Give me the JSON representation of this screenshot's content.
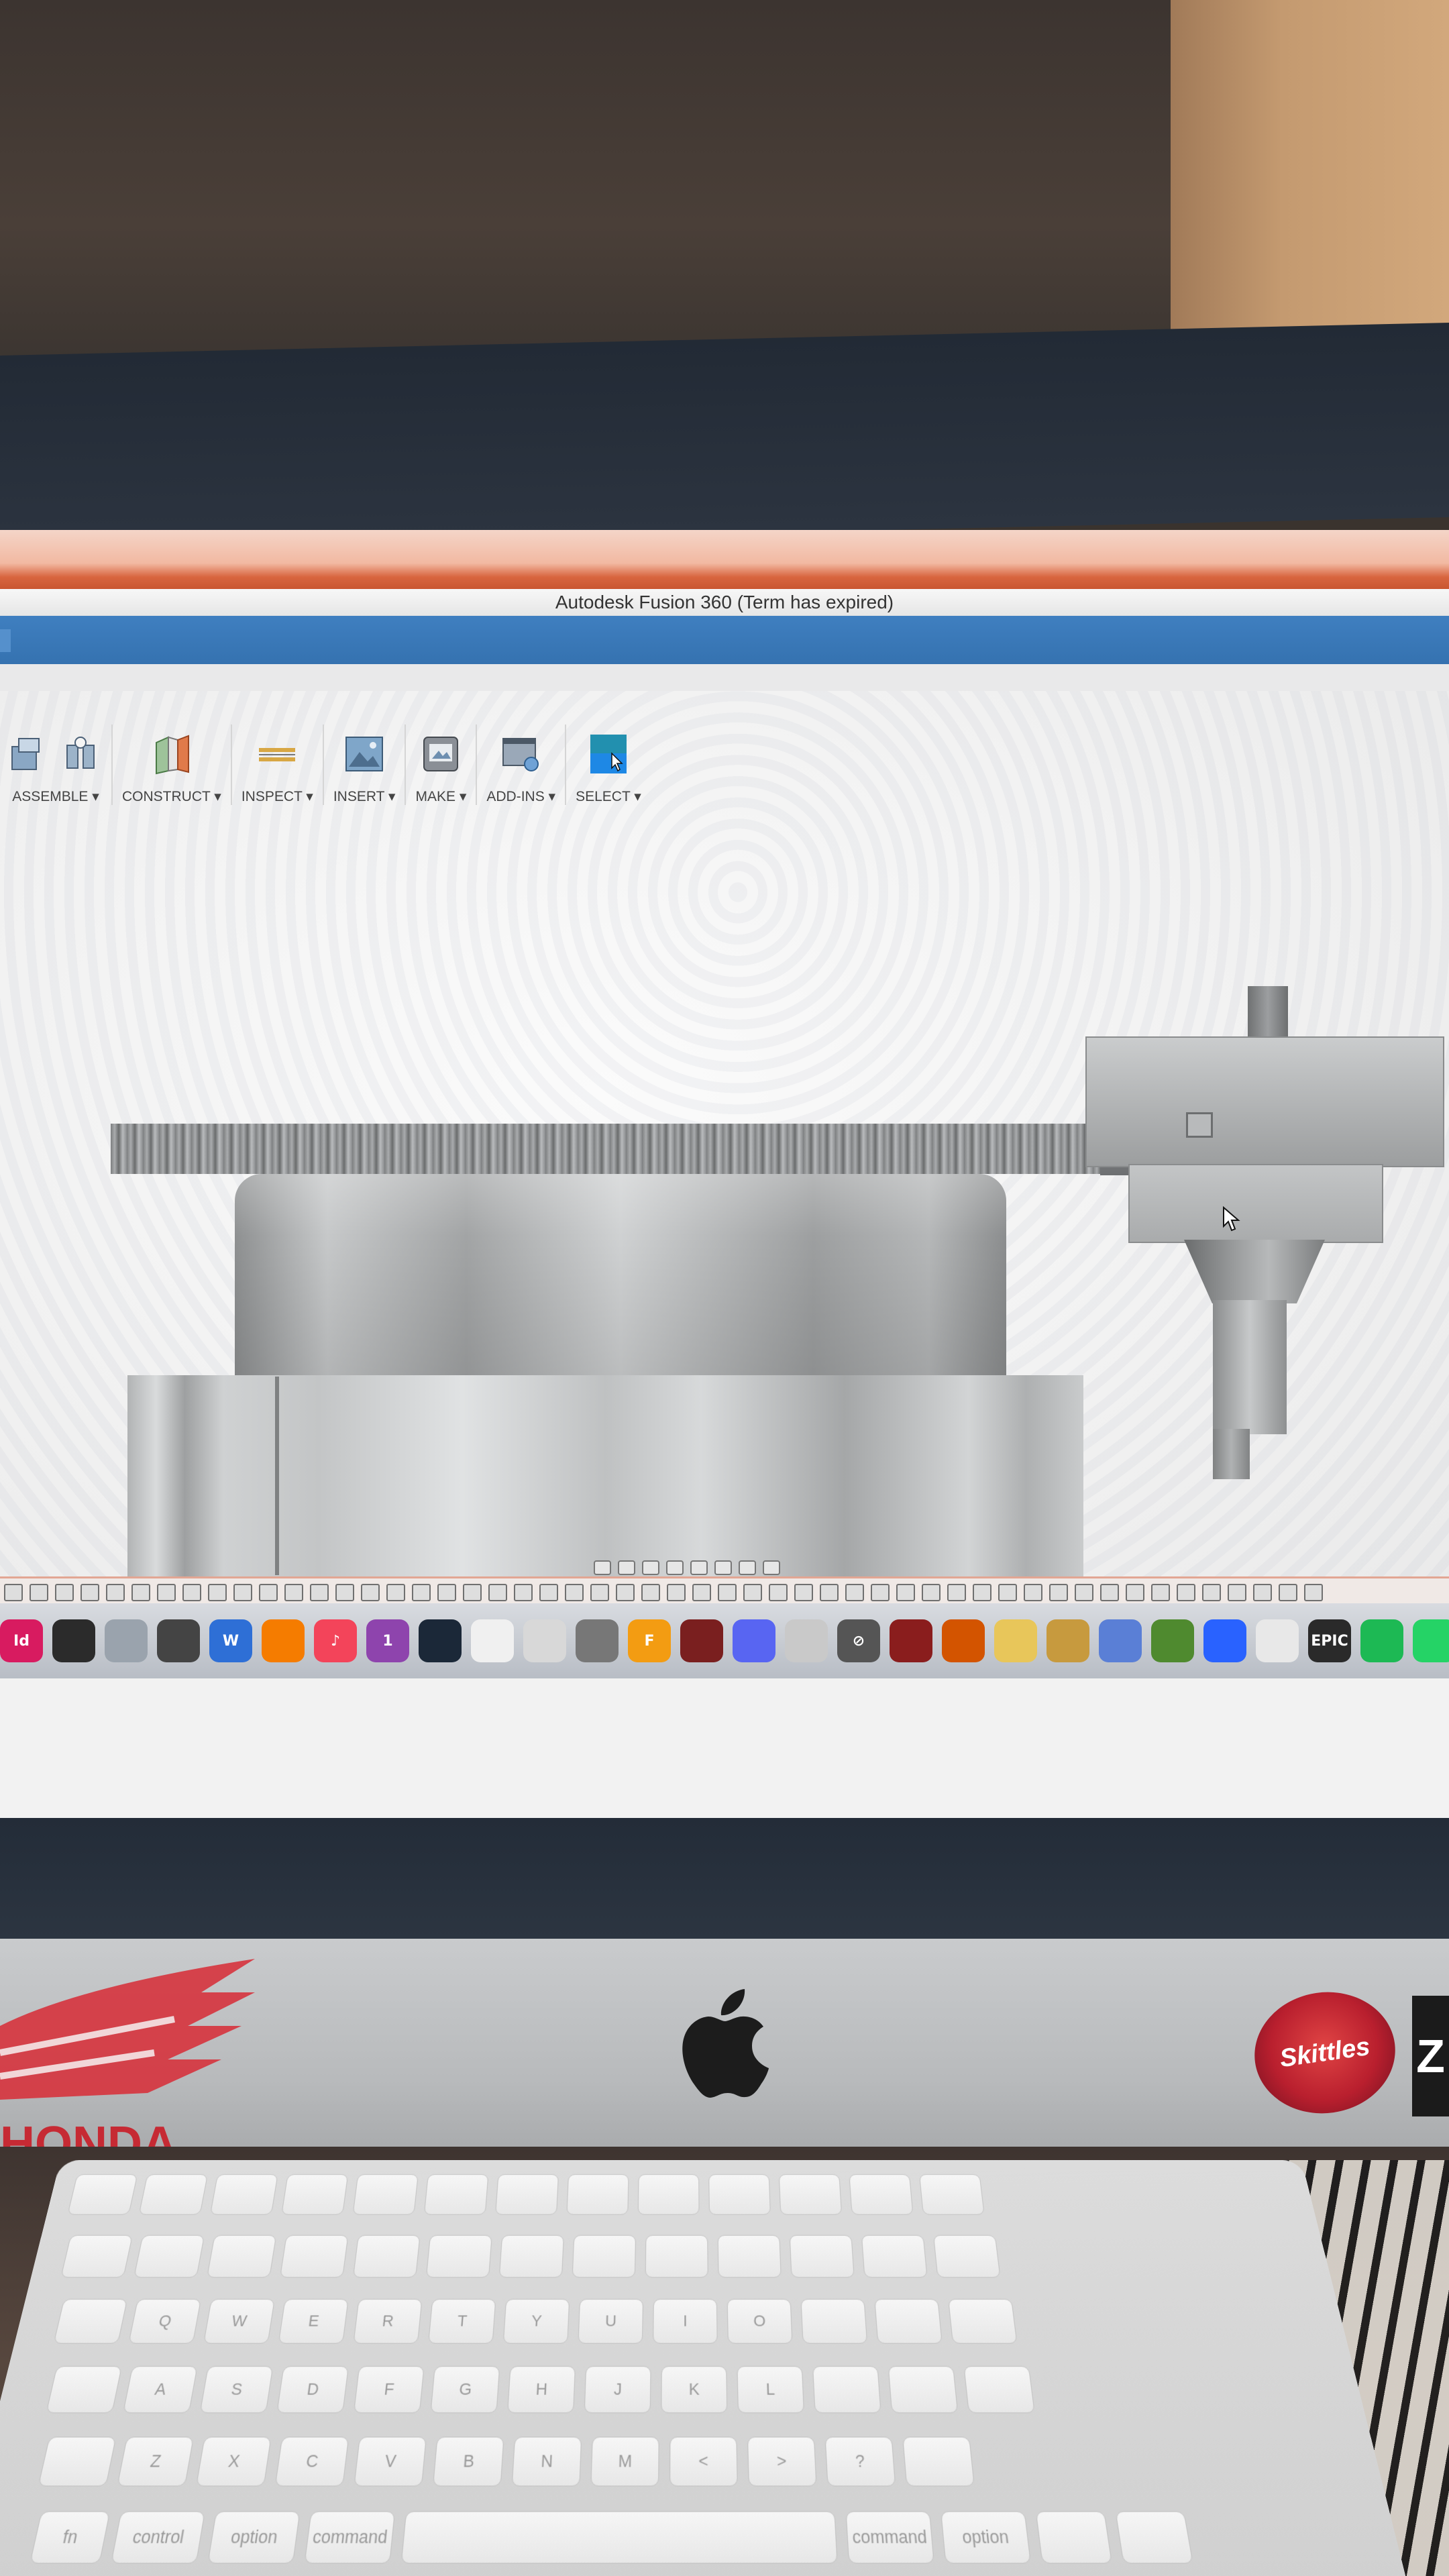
{
  "window": {
    "title": "Autodesk Fusion 360 (Term has expired)"
  },
  "toolbar": {
    "groups": [
      {
        "label": "ASSEMBLE ▾"
      },
      {
        "label": "CONSTRUCT ▾"
      },
      {
        "label": "INSPECT ▾"
      },
      {
        "label": "INSERT ▾"
      },
      {
        "label": "MAKE ▾"
      },
      {
        "label": "ADD-INS ▾"
      },
      {
        "label": "SELECT ▾"
      }
    ],
    "icons": {
      "assemble": [
        "new-component-icon",
        "joint-icon"
      ],
      "construct": "offset-plane-icon",
      "inspect": "measure-icon",
      "insert": "insert-image-icon",
      "make": "3d-print-icon",
      "add_ins": "scripts-addins-icon",
      "select": "select-cursor-icon"
    },
    "select_color": "#1e88e5"
  },
  "dock": {
    "apps": [
      {
        "name": "indesign-app-icon",
        "label": "Id",
        "color": "#d81b60"
      },
      {
        "name": "pen-app-icon",
        "label": "",
        "color": "#2b2b2b"
      },
      {
        "name": "launchpad-app-icon",
        "label": "",
        "color": "#9aa3ad"
      },
      {
        "name": "collage-app-icon",
        "label": "",
        "color": "#444"
      },
      {
        "name": "word-app-icon",
        "label": "W",
        "color": "#2e6fd6"
      },
      {
        "name": "books-app-icon",
        "label": "",
        "color": "#f57c00"
      },
      {
        "name": "music-app-icon",
        "label": "♪",
        "color": "#f3445a"
      },
      {
        "name": "one-app-icon",
        "label": "1",
        "color": "#8e44ad"
      },
      {
        "name": "steam-app-icon",
        "label": "",
        "color": "#1b2838"
      },
      {
        "name": "photos-app-icon",
        "label": "",
        "color": "#f0f0f0"
      },
      {
        "name": "finder-ghost-app-icon",
        "label": "",
        "color": "#d8d8d8"
      },
      {
        "name": "camera-app-icon",
        "label": "",
        "color": "#777"
      },
      {
        "name": "fusion-app-icon",
        "label": "F",
        "color": "#f39c12"
      },
      {
        "name": "winrar-app-icon",
        "label": "",
        "color": "#7a1f1f"
      },
      {
        "name": "discord-app-icon",
        "label": "",
        "color": "#5865f2"
      },
      {
        "name": "vmware-app-icon",
        "label": "",
        "color": "#c9c9c9"
      },
      {
        "name": "blocked-app-icon",
        "label": "⊘",
        "color": "#555"
      },
      {
        "name": "rar-app-icon",
        "label": "",
        "color": "#8a1d1d"
      },
      {
        "name": "tools-app-icon",
        "label": "",
        "color": "#d35400"
      },
      {
        "name": "preview-app-icon",
        "label": "",
        "color": "#e8c65a"
      },
      {
        "name": "crown-app-icon",
        "label": "",
        "color": "#c79a3e"
      },
      {
        "name": "bird-app-icon",
        "label": "",
        "color": "#5a7fd6"
      },
      {
        "name": "minecraft-app-icon",
        "label": "",
        "color": "#4f8a2f"
      },
      {
        "name": "fan-app-icon",
        "label": "",
        "color": "#2962ff"
      },
      {
        "name": "pages-app-icon",
        "label": "",
        "color": "#e8e8e8"
      },
      {
        "name": "epic-games-app-icon",
        "label": "EPIC",
        "color": "#2a2a2a"
      },
      {
        "name": "spotify-app-icon",
        "label": "",
        "color": "#1db954"
      },
      {
        "name": "whatsapp-app-icon",
        "label": "",
        "color": "#25d366"
      }
    ]
  },
  "stickers": {
    "honda": "HONDA",
    "skittles": "Skittles",
    "z_letter": "Z"
  },
  "keyboard": {
    "rows": [
      [
        "",
        "",
        "",
        "",
        "",
        "",
        "",
        "",
        "",
        "",
        "",
        "",
        ""
      ],
      [
        "",
        "",
        "",
        "",
        "",
        "",
        "",
        "",
        "",
        "",
        "",
        "",
        ""
      ],
      [
        "",
        "Q",
        "W",
        "E",
        "R",
        "T",
        "Y",
        "U",
        "I",
        "O",
        "",
        "",
        ""
      ],
      [
        "",
        "A",
        "S",
        "D",
        "F",
        "G",
        "H",
        "J",
        "K",
        "L",
        "",
        "",
        ""
      ],
      [
        "",
        "Z",
        "X",
        "C",
        "V",
        "B",
        "N",
        "M",
        "<",
        ">",
        "?",
        ""
      ],
      [
        "fn",
        "control",
        "option",
        "command",
        "",
        "command",
        "option",
        "",
        ""
      ]
    ]
  }
}
